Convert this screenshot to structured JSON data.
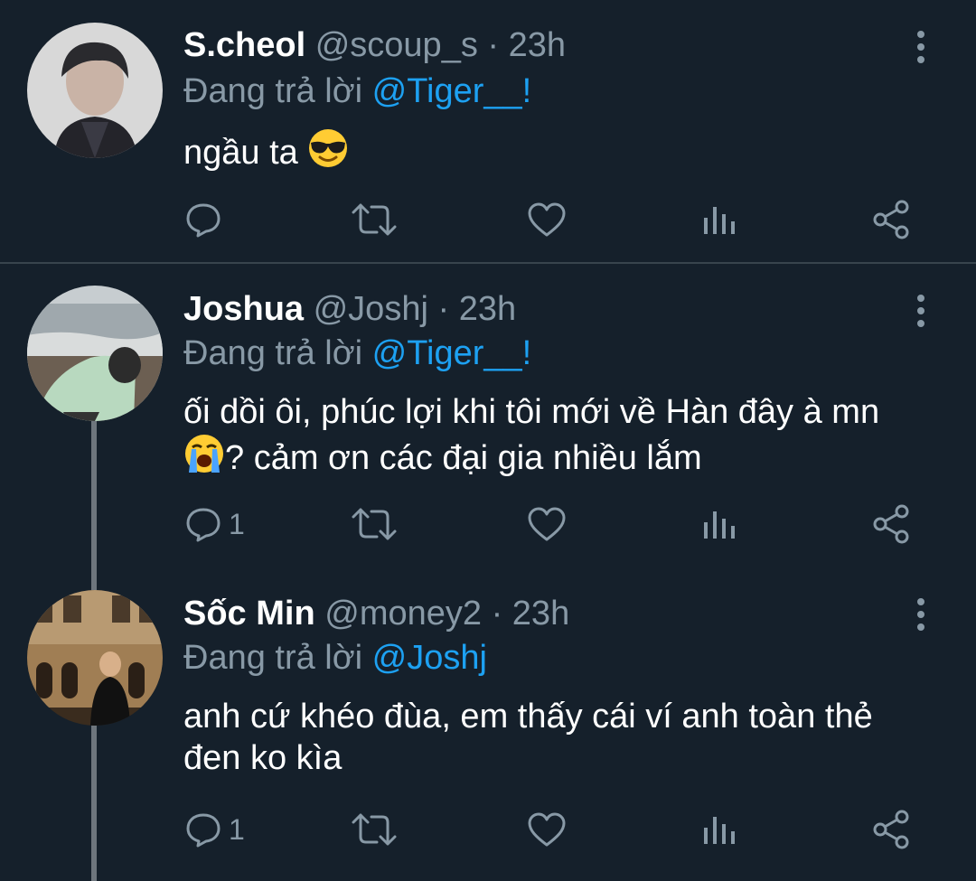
{
  "tweets": [
    {
      "name": "S.cheol",
      "handle": "@scoup_s",
      "time": "23h",
      "replying_prefix": "Đang trả lời",
      "replying_to": "@Tiger__!",
      "text": "ngầu ta",
      "emoji": "smiling-face-with-sunglasses",
      "reply_count": "",
      "icons": [
        "reply-icon",
        "retweet-icon",
        "like-icon",
        "analytics-icon",
        "share-icon",
        "more-icon"
      ]
    },
    {
      "name": "Joshua",
      "handle": "@Joshj",
      "time": "23h",
      "replying_prefix": "Đang trả lời",
      "replying_to": "@Tiger__!",
      "text_line1": "ối dồi ôi, phúc lợi khi tôi mới về Hàn đây à mn",
      "text_line2": "? cảm ơn các đại gia nhiều lắm",
      "emoji": "loudly-crying-face",
      "reply_count": "1"
    },
    {
      "name": "Sốc Min",
      "handle": "@money2",
      "time": "23h",
      "replying_prefix": "Đang trả lời",
      "replying_to": "@Joshj",
      "text_line1": "anh cứ khéo đùa, em thấy cái ví anh toàn thẻ",
      "text_line2": "đen ko kìa",
      "reply_count": "1"
    }
  ],
  "separator": "·",
  "colors": {
    "background": "#15202b",
    "text": "#ffffff",
    "secondary": "#8899a6",
    "accent": "#1da1f2",
    "divider": "#38444d"
  }
}
